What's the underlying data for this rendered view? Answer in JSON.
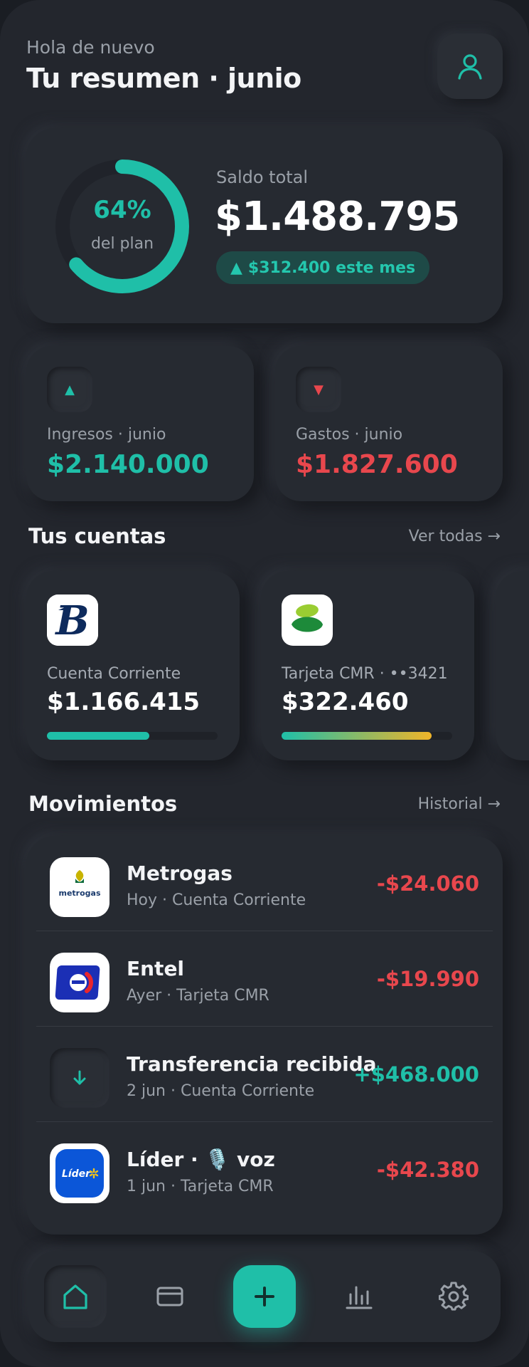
{
  "header": {
    "greeting": "Hola de nuevo",
    "title": "Tu resumen · junio",
    "profile_icon": "user-icon"
  },
  "balance": {
    "plan_percent_text": "64%",
    "plan_progress": 0.64,
    "plan_label": "del plan",
    "label": "Saldo total",
    "value": "$1.488.795",
    "change_arrow": "▲",
    "change": "$312.400 este mes"
  },
  "stats": {
    "income": {
      "arrow": "▲",
      "label": "Ingresos · junio",
      "value": "$2.140.000",
      "color": "#1fbfa8"
    },
    "expenses": {
      "arrow": "▼",
      "label": "Gastos · junio",
      "value": "$1.827.600",
      "color": "#e8474d"
    }
  },
  "accounts": {
    "title": "Tus cuentas",
    "link": "Ver todas →",
    "items": [
      {
        "name": "Cuenta Corriente",
        "value": "$1.166.415",
        "logo": "bank-b-logo",
        "progress": 0.6
      },
      {
        "name": "Tarjeta CMR · ••3421",
        "value": "$322.460",
        "logo": "cmr-leaf-logo",
        "progress": 0.88
      }
    ]
  },
  "movements": {
    "title": "Movimientos",
    "link": "Historial →",
    "items": [
      {
        "name": "Metrogas",
        "sub": "Hoy · Cuenta Corriente",
        "amount": "-$24.060",
        "logo": "metrogas-logo",
        "logo_text": "metrogas"
      },
      {
        "name": "Entel",
        "sub": "Ayer · Tarjeta CMR",
        "amount": "-$19.990",
        "logo": "entel-logo"
      },
      {
        "name": "Transferencia recibida",
        "sub": "2 jun · Cuenta Corriente",
        "amount": "+$468.000",
        "logo": "arrow-down-icon"
      },
      {
        "name": "Líder · 🎙️ voz",
        "sub": "1 jun · Tarjeta CMR",
        "amount": "-$42.380",
        "logo": "lider-logo",
        "logo_text": "Líder"
      }
    ]
  },
  "nav": {
    "items": [
      "home-icon",
      "card-icon",
      "plus-icon",
      "chart-icon",
      "gear-icon"
    ],
    "active": "home"
  },
  "colors": {
    "accent": "#1fbfa8",
    "negative": "#e8474d",
    "background": "#23262d"
  }
}
